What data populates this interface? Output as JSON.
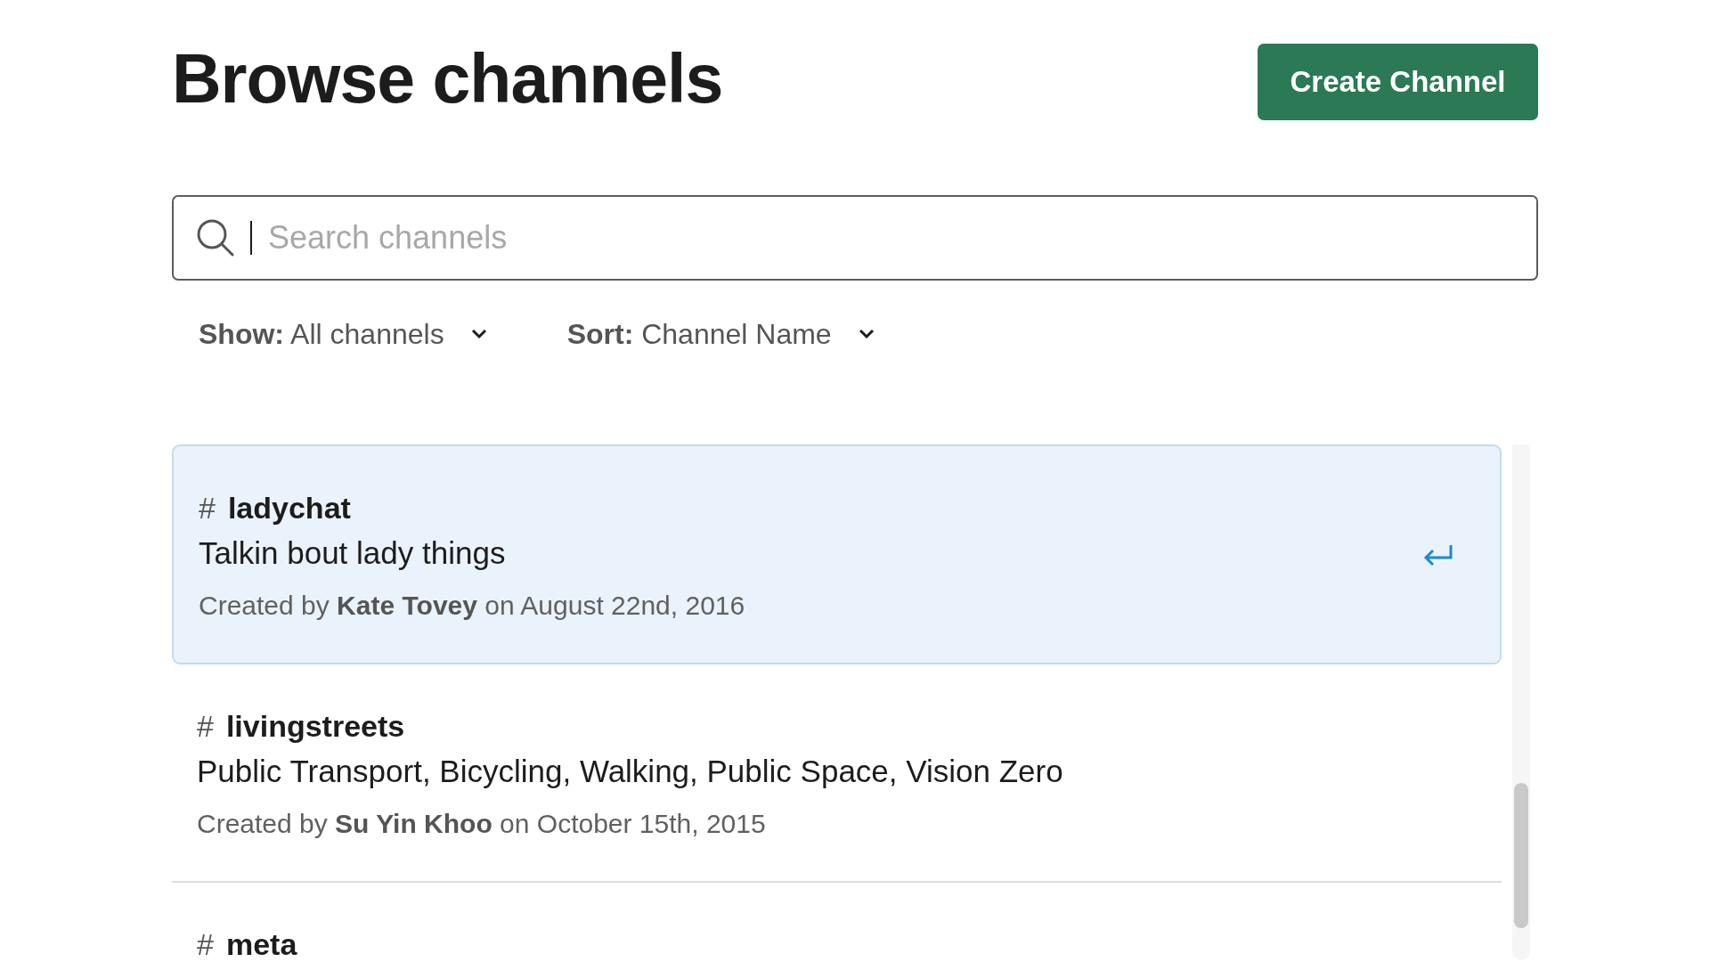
{
  "title": "Browse channels",
  "create_button": "Create Channel",
  "search": {
    "placeholder": "Search channels"
  },
  "filters": [
    {
      "label": "Show:",
      "value": "All channels"
    },
    {
      "label": "Sort:",
      "value": "Channel Name"
    }
  ],
  "channels": [
    {
      "prefix": "#",
      "name": "ladychat",
      "description": "Talkin bout lady things",
      "created": "Created by **Kate Tovey** on August 22nd, 2016",
      "selected": true
    },
    {
      "prefix": "#",
      "name": "livingstreets",
      "description": "Public Transport, Bicycling, Walking, Public Space, Vision Zero",
      "created": "Created by **Su Yin Khoo** on October 15th, 2015",
      "selected": false
    },
    {
      "prefix": "#",
      "name": "meta",
      "selected": false
    }
  ]
}
